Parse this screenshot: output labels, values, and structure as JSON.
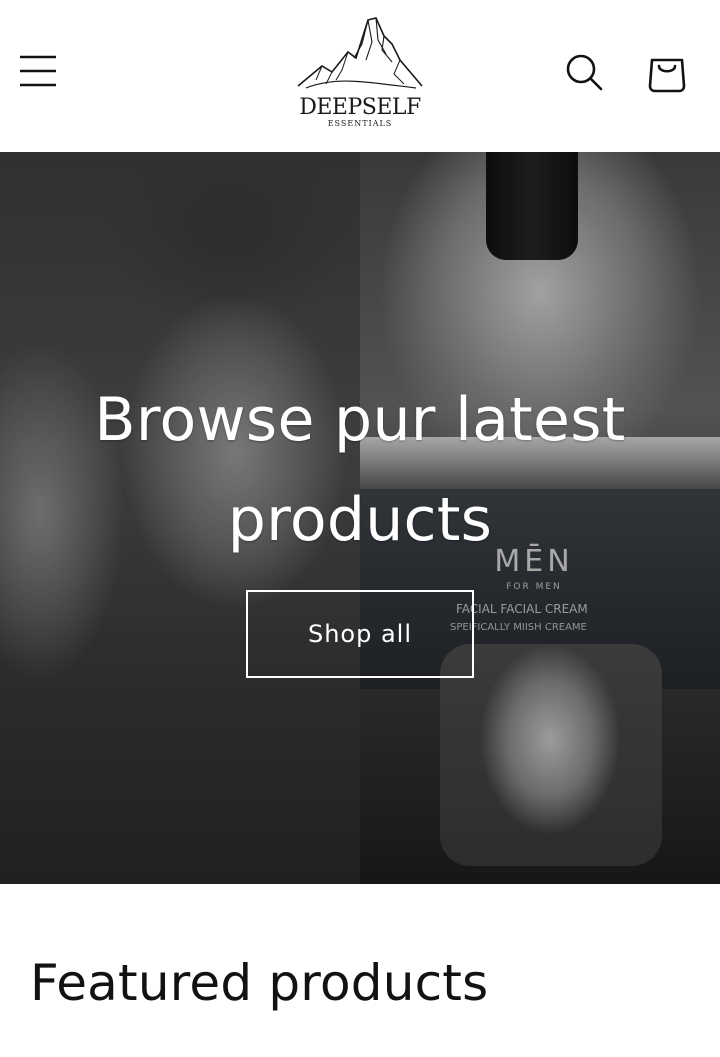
{
  "header": {
    "logo": {
      "name": "DEEPSELF",
      "subtitle": "ESSENTIALS",
      "icon": "mountain-logo-icon"
    },
    "menu_icon": "hamburger-menu-icon",
    "search_icon": "search-icon",
    "cart_icon": "cart-bag-icon"
  },
  "hero": {
    "heading": "Browse pur latest products",
    "button_label": "Shop all",
    "product_label": {
      "brand": "MĒN",
      "brand_sub": "FOR MEN",
      "line1": "FACIAL FACIAL CREAM",
      "line2": "SPEIFICALLY MIISH CREAME"
    }
  },
  "featured": {
    "title": "Featured products"
  },
  "colors": {
    "text": "#121212",
    "background": "#ffffff",
    "hero_text": "#ffffff"
  }
}
